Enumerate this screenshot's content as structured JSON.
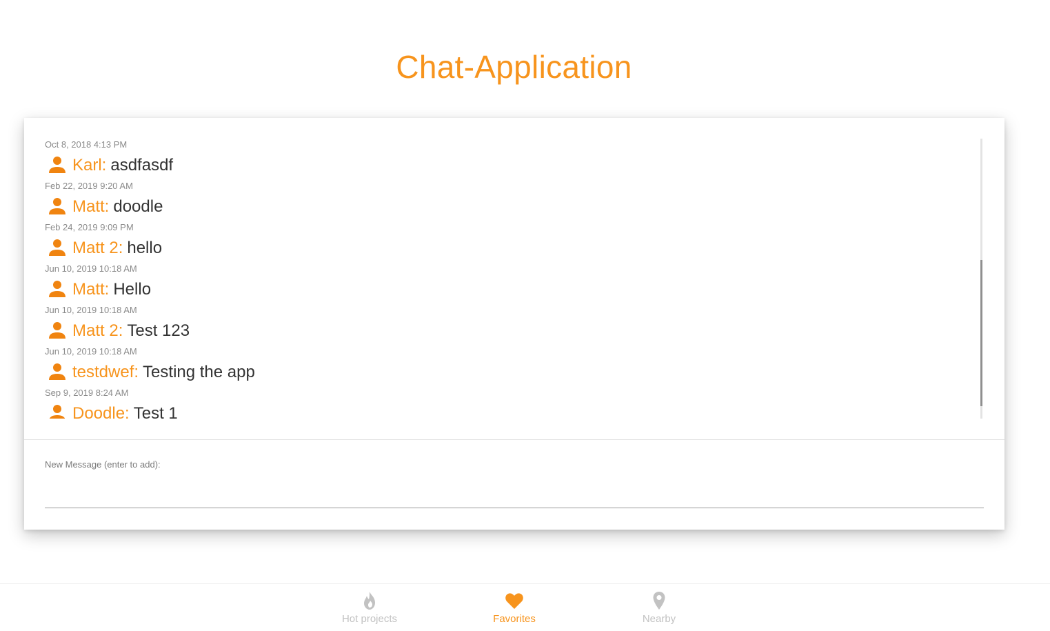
{
  "app": {
    "title": "Chat-Application"
  },
  "colors": {
    "accent": "#f7941d",
    "icon": "#f08410",
    "inactive": "#c2c2c2"
  },
  "messages": [
    {
      "timestamp": "Oct 8, 2018 4:13 PM",
      "author": "Karl:",
      "text": "asdfasdf",
      "icon": "person-icon"
    },
    {
      "timestamp": "Feb 22, 2019 9:20 AM",
      "author": "Matt:",
      "text": "doodle",
      "icon": "person-icon"
    },
    {
      "timestamp": "Feb 24, 2019 9:09 PM",
      "author": "Matt 2:",
      "text": "hello",
      "icon": "person-icon"
    },
    {
      "timestamp": "Jun 10, 2019 10:18 AM",
      "author": "Matt:",
      "text": "Hello",
      "icon": "person-icon"
    },
    {
      "timestamp": "Jun 10, 2019 10:18 AM",
      "author": "Matt 2:",
      "text": "Test 123",
      "icon": "person-icon"
    },
    {
      "timestamp": "Jun 10, 2019 10:18 AM",
      "author": "testdwef:",
      "text": "Testing the app",
      "icon": "person-icon"
    },
    {
      "timestamp": "Sep 9, 2019 8:24 AM",
      "author": "Doodle:",
      "text": "Test 1",
      "icon": "person-icon"
    }
  ],
  "composer": {
    "label": "New Message (enter to add):",
    "value": "",
    "placeholder": ""
  },
  "nav": {
    "items": [
      {
        "label": "Hot projects",
        "icon": "flame-icon",
        "active": false
      },
      {
        "label": "Favorites",
        "icon": "heart-icon",
        "active": true
      },
      {
        "label": "Nearby",
        "icon": "map-pin-icon",
        "active": false
      }
    ]
  }
}
